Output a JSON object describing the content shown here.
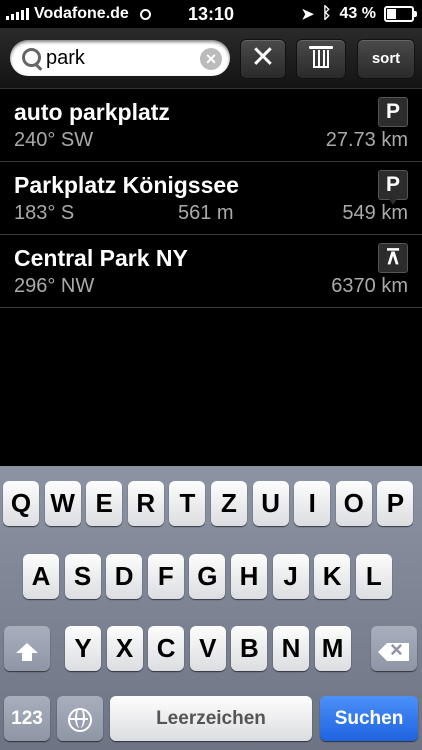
{
  "status_bar": {
    "carrier": "Vodafone.de",
    "time": "13:10",
    "battery": "43 %",
    "battery_level": 0.43
  },
  "toolbar": {
    "search_value": "park",
    "clear_label": "×",
    "close_label": "✕",
    "sort_label": "sort"
  },
  "results": [
    {
      "name": "auto parkplatz",
      "bearing": "240° SW",
      "walk": "",
      "distance": "27.73 km",
      "poi": "P",
      "poi_icon": "parking-icon"
    },
    {
      "name": "Parkplatz Königssee",
      "bearing": "183° S",
      "walk": "561 m",
      "distance": "549 km",
      "poi": "P",
      "poi_icon": "parking-icon"
    },
    {
      "name": "Central Park NY",
      "bearing": "296° NW",
      "walk": "",
      "distance": "6370 km",
      "poi": "⊼",
      "poi_icon": "picnic-table-icon"
    }
  ],
  "keyboard": {
    "row1": [
      "Q",
      "W",
      "E",
      "R",
      "T",
      "Z",
      "U",
      "I",
      "O",
      "P"
    ],
    "row2": [
      "A",
      "S",
      "D",
      "F",
      "G",
      "H",
      "J",
      "K",
      "L"
    ],
    "row3": [
      "Y",
      "X",
      "C",
      "V",
      "B",
      "N",
      "M"
    ],
    "numbers_label": "123",
    "space_label": "Leerzeichen",
    "go_label": "Suchen"
  }
}
